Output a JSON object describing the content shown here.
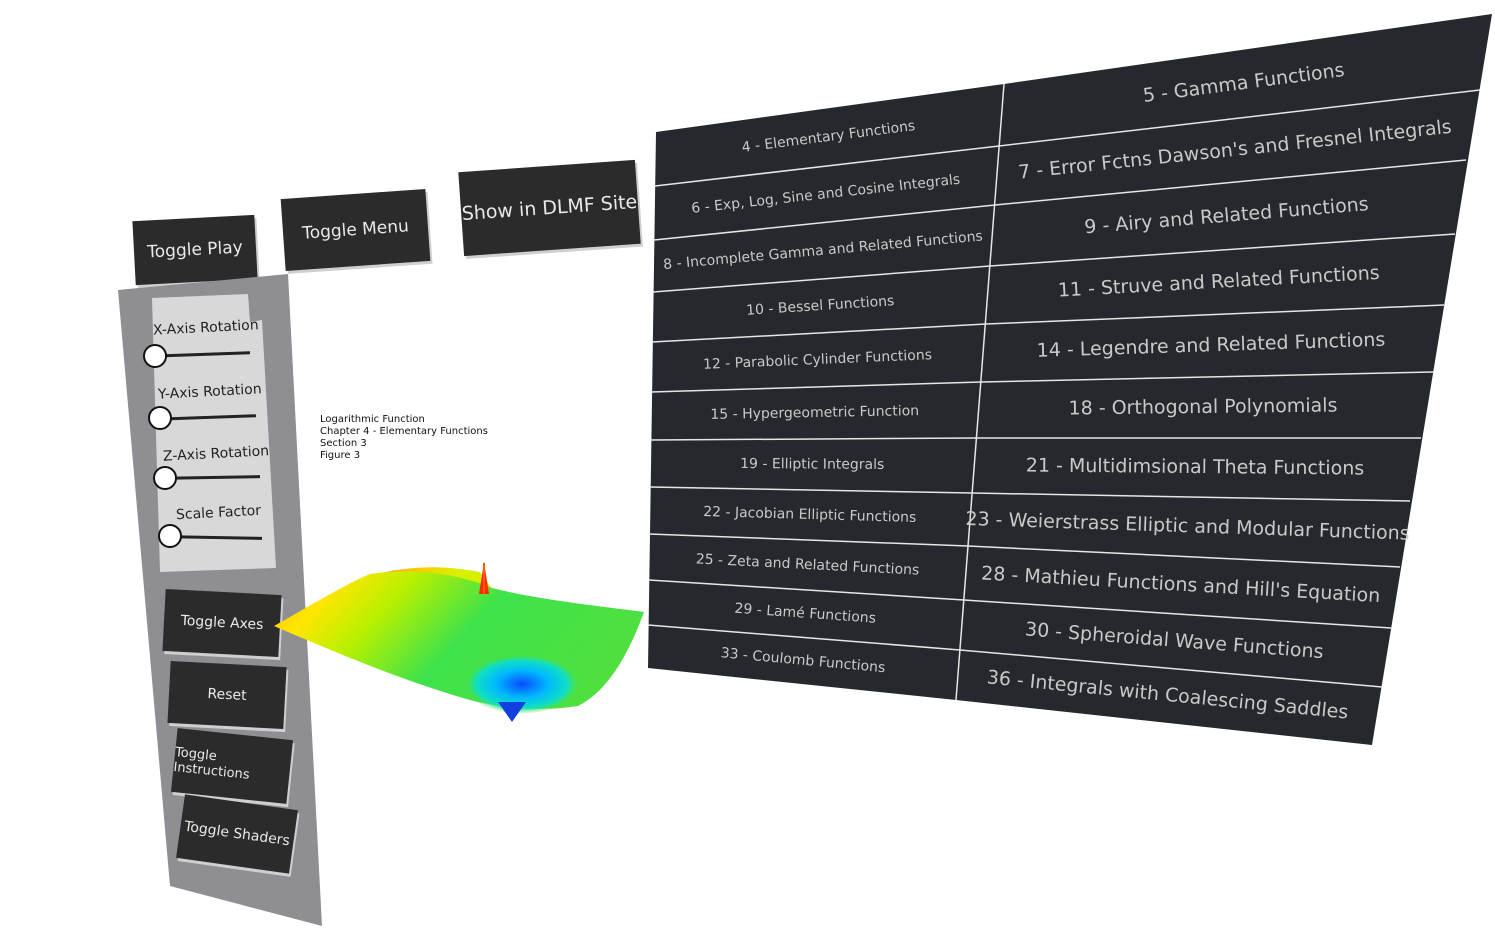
{
  "top_buttons": {
    "toggle_play": "Toggle Play",
    "toggle_menu": "Toggle Menu",
    "show_dlmf": "Show in DLMF Site"
  },
  "sliders": [
    {
      "label": "X-Axis Rotation",
      "value": 0
    },
    {
      "label": "Y-Axis Rotation",
      "value": 0
    },
    {
      "label": "Z-Axis Rotation",
      "value": 0
    },
    {
      "label": "Scale Factor",
      "value": 0
    }
  ],
  "side_buttons": {
    "toggle_axes": "Toggle Axes",
    "reset": "Reset",
    "toggle_instructions": "Toggle Instructions",
    "toggle_shaders": "Toggle Shaders"
  },
  "caption": {
    "line1": "Logarithmic Function",
    "line2": "Chapter 4 - Elementary Functions",
    "line3": "Section 3",
    "line4": "Figure 3"
  },
  "chapters_left": [
    "4 - Elementary Functions",
    "6 - Exp, Log, Sine and Cosine Integrals",
    "8 - Incomplete Gamma and Related Functions",
    "10 - Bessel Functions",
    "12 - Parabolic Cylinder Functions",
    "15 - Hypergeometric Function",
    "19 - Elliptic Integrals",
    "22 - Jacobian Elliptic Functions",
    "25 - Zeta and Related Functions",
    "29 - Lamé Functions",
    "33 - Coulomb Functions"
  ],
  "chapters_right": [
    "5 - Gamma Functions",
    "7 - Error Fctns Dawson's and Fresnel Integrals",
    "9 - Airy and Related Functions",
    "11 - Struve and Related Functions",
    "14 - Legendre and Related Functions",
    "18 - Orthogonal Polynomials",
    "21 - Multidimsional Theta Functions",
    "23 - Weierstrass Elliptic and Modular Functions",
    "28 - Mathieu Functions and Hill's Equation",
    "30 - Spheroidal Wave Functions",
    "36 - Integrals with Coalescing Saddles"
  ],
  "colors": {
    "menu_bg": "#25282c",
    "menu_text": "#c9c9c9",
    "panel_bg": "#8f8f93",
    "button_bg": "#2b2b2b"
  }
}
